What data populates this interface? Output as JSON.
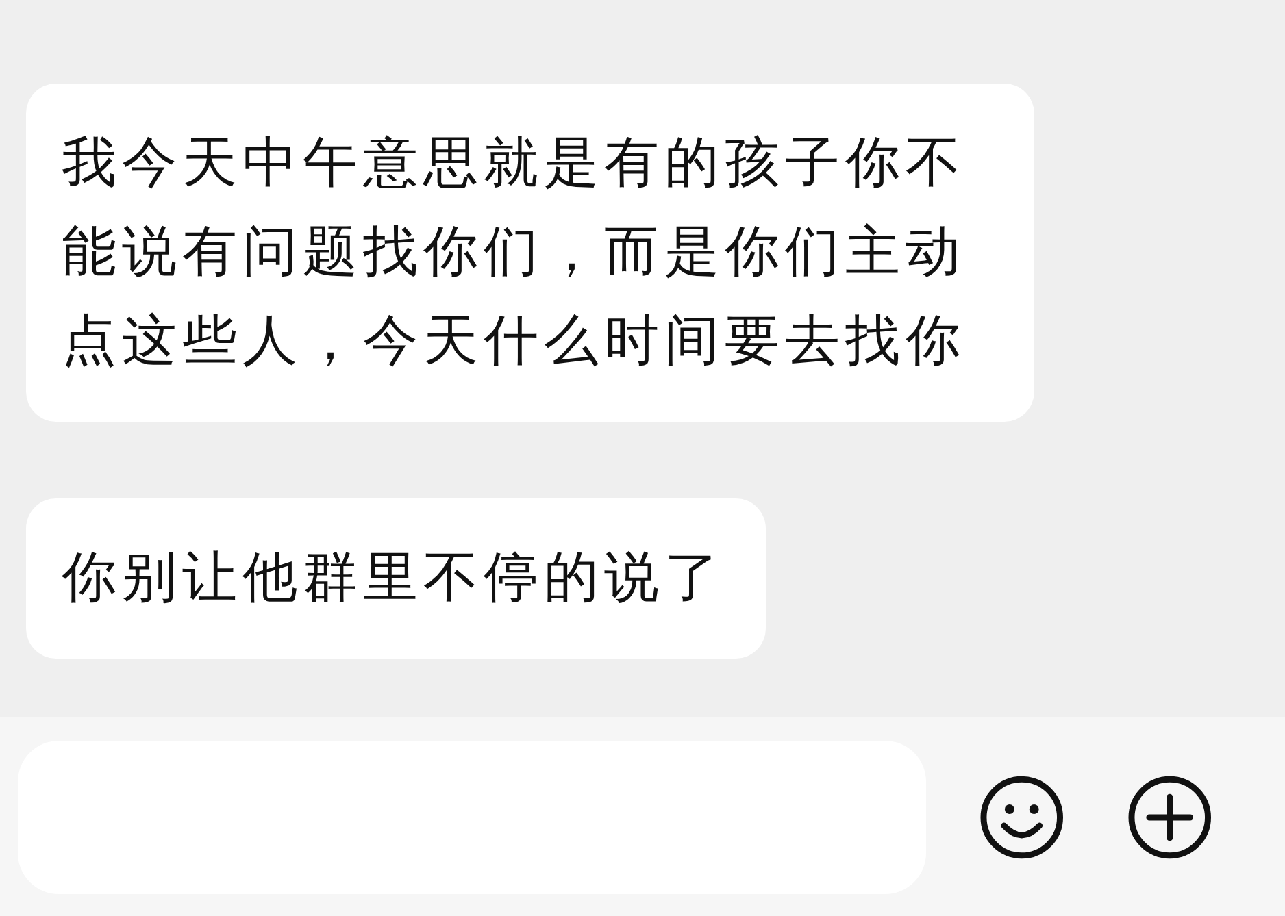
{
  "messages": [
    {
      "text": "我今天中午意思就是有的孩子你不能说有问题找你们，而是你们主动点这些人，今天什么时间要去找你"
    },
    {
      "text": "你别让他群里不停的说了"
    }
  ]
}
